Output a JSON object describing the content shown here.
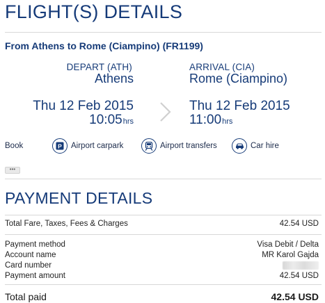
{
  "flight": {
    "heading": "FLIGHT(S) DETAILS",
    "route_title": "From Athens to Rome (Ciampino) (FR1199)",
    "depart": {
      "label": "DEPART (ATH)",
      "city": "Athens",
      "date": "Thu 12 Feb 2015",
      "time": "10:05",
      "time_unit": "hrs"
    },
    "arrival": {
      "label": "ARRIVAL (CIA)",
      "city": "Rome (Ciampino)",
      "date": "Thu 12 Feb 2015",
      "time": "11:00",
      "time_unit": "hrs"
    },
    "direction_icon": "chevron-right-icon"
  },
  "toolbar": {
    "book_label": "Book",
    "items": [
      {
        "label": "Airport carpark",
        "icon": "parking-icon"
      },
      {
        "label": "Airport transfers",
        "icon": "train-icon"
      },
      {
        "label": "Car hire",
        "icon": "car-icon"
      }
    ],
    "more_label": "•••"
  },
  "payment": {
    "heading": "PAYMENT DETAILS",
    "fare_label": "Total Fare, Taxes, Fees & Charges",
    "fare_value": "42.54 USD",
    "method_label": "Payment method",
    "method_value": "Visa Debit / Delta",
    "account_label": "Account name",
    "account_value": "MR Karol Gajda",
    "card_label": "Card number",
    "amount_label": "Payment amount",
    "amount_value": "42.54 USD",
    "total_label": "Total paid",
    "total_value": "42.54 USD"
  },
  "colors": {
    "accent": "#153a78",
    "divider": "#d8d8d8",
    "chevron": "#d0d0d0"
  }
}
